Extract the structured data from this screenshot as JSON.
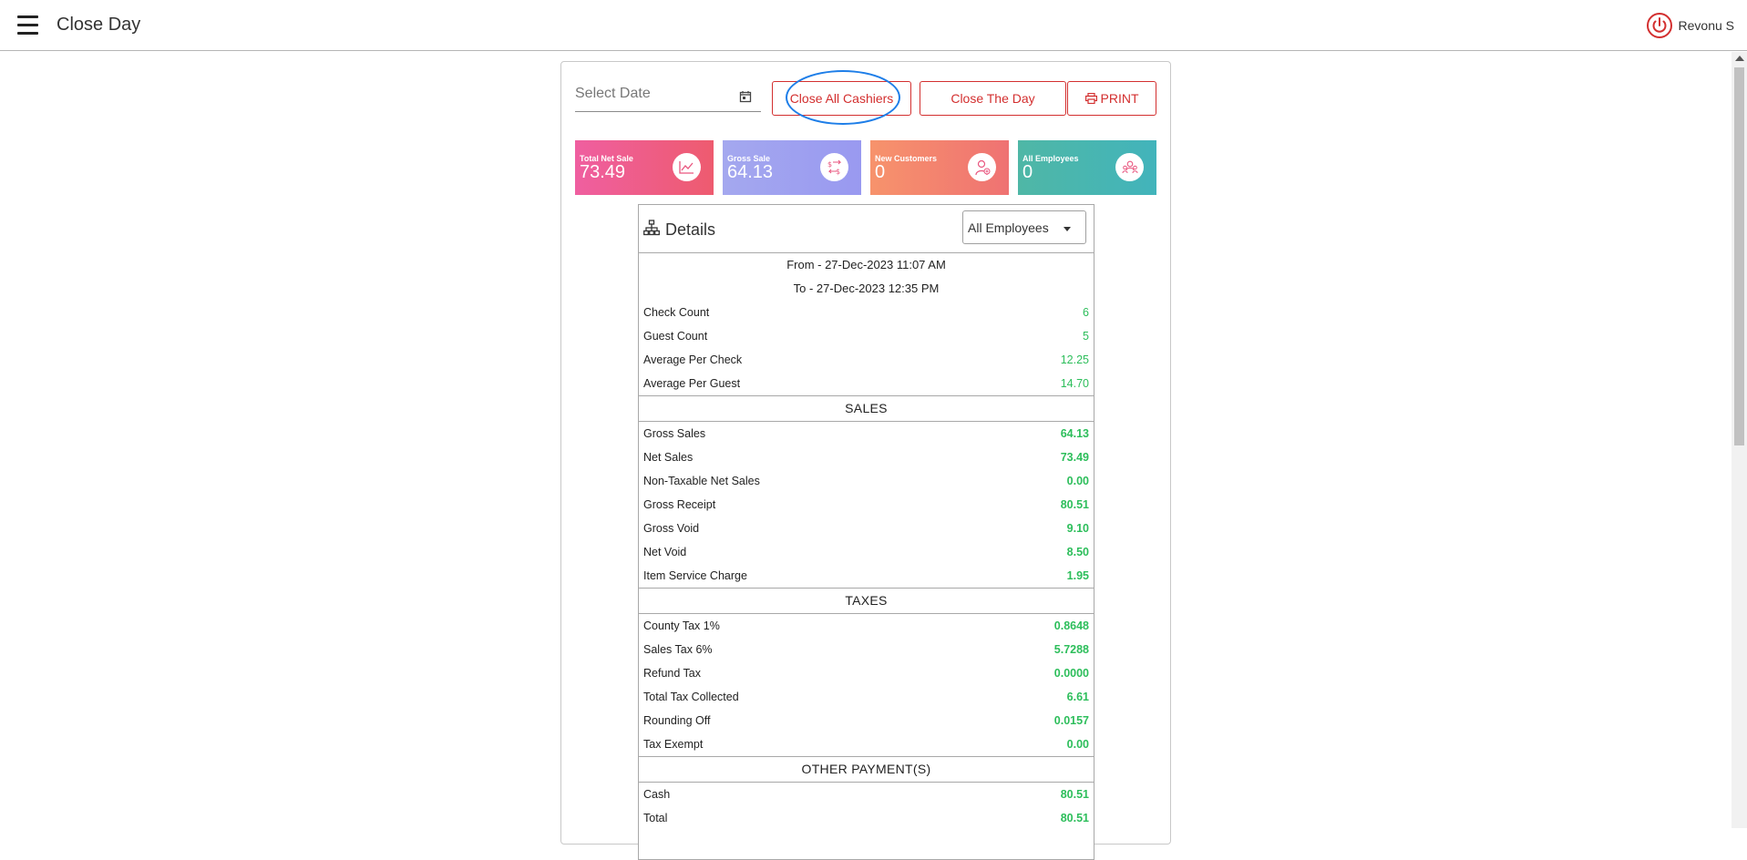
{
  "header": {
    "title": "Close Day",
    "user_name": "Revonu S"
  },
  "toolbar": {
    "date_placeholder": "Select Date",
    "close_all_cashiers_label": "Close All Cashiers",
    "close_day_label": "Close The Day",
    "print_label": "PRINT"
  },
  "tiles": [
    {
      "label": "Total Net Sale",
      "value": "73.49",
      "icon": "line-chart-icon"
    },
    {
      "label": "Gross Sale",
      "value": "64.13",
      "icon": "money-exchange-icon"
    },
    {
      "label": "New Customers",
      "value": "0",
      "icon": "new-customer-icon"
    },
    {
      "label": "All Employees",
      "value": "0",
      "icon": "employees-icon"
    }
  ],
  "details": {
    "title": "Details",
    "employee_filter": "All Employees",
    "from": "From - 27-Dec-2023 11:07 AM",
    "to": "To - 27-Dec-2023 12:35 PM",
    "summary": [
      {
        "label": "Check Count",
        "value": "6"
      },
      {
        "label": "Guest Count",
        "value": "5"
      },
      {
        "label": "Average Per Check",
        "value": "12.25"
      },
      {
        "label": "Average Per Guest",
        "value": "14.70"
      }
    ],
    "sales_heading": "SALES",
    "sales": [
      {
        "label": "Gross Sales",
        "value": "64.13"
      },
      {
        "label": "Net Sales",
        "value": "73.49"
      },
      {
        "label": "Non-Taxable Net Sales",
        "value": "0.00"
      },
      {
        "label": "Gross Receipt",
        "value": "80.51"
      },
      {
        "label": "Gross Void",
        "value": "9.10"
      },
      {
        "label": "Net Void",
        "value": "8.50"
      },
      {
        "label": "Item Service Charge",
        "value": "1.95"
      }
    ],
    "taxes_heading": "TAXES",
    "taxes": [
      {
        "label": "County Tax 1%",
        "value": "0.8648"
      },
      {
        "label": "Sales Tax 6%",
        "value": "5.7288"
      },
      {
        "label": "Refund Tax",
        "value": "0.0000"
      },
      {
        "label": "Total Tax Collected",
        "value": "6.61"
      },
      {
        "label": "Rounding Off",
        "value": "0.0157"
      },
      {
        "label": "Tax Exempt",
        "value": "0.00"
      }
    ],
    "payments_heading": "OTHER PAYMENT(S)",
    "payments": [
      {
        "label": "Cash",
        "value": "80.51"
      },
      {
        "label": "Total",
        "value": "80.51"
      }
    ]
  },
  "colors": {
    "accent_red": "#d32f2f",
    "value_green": "#2dbe5b",
    "highlight_blue": "#1e7ee8"
  }
}
